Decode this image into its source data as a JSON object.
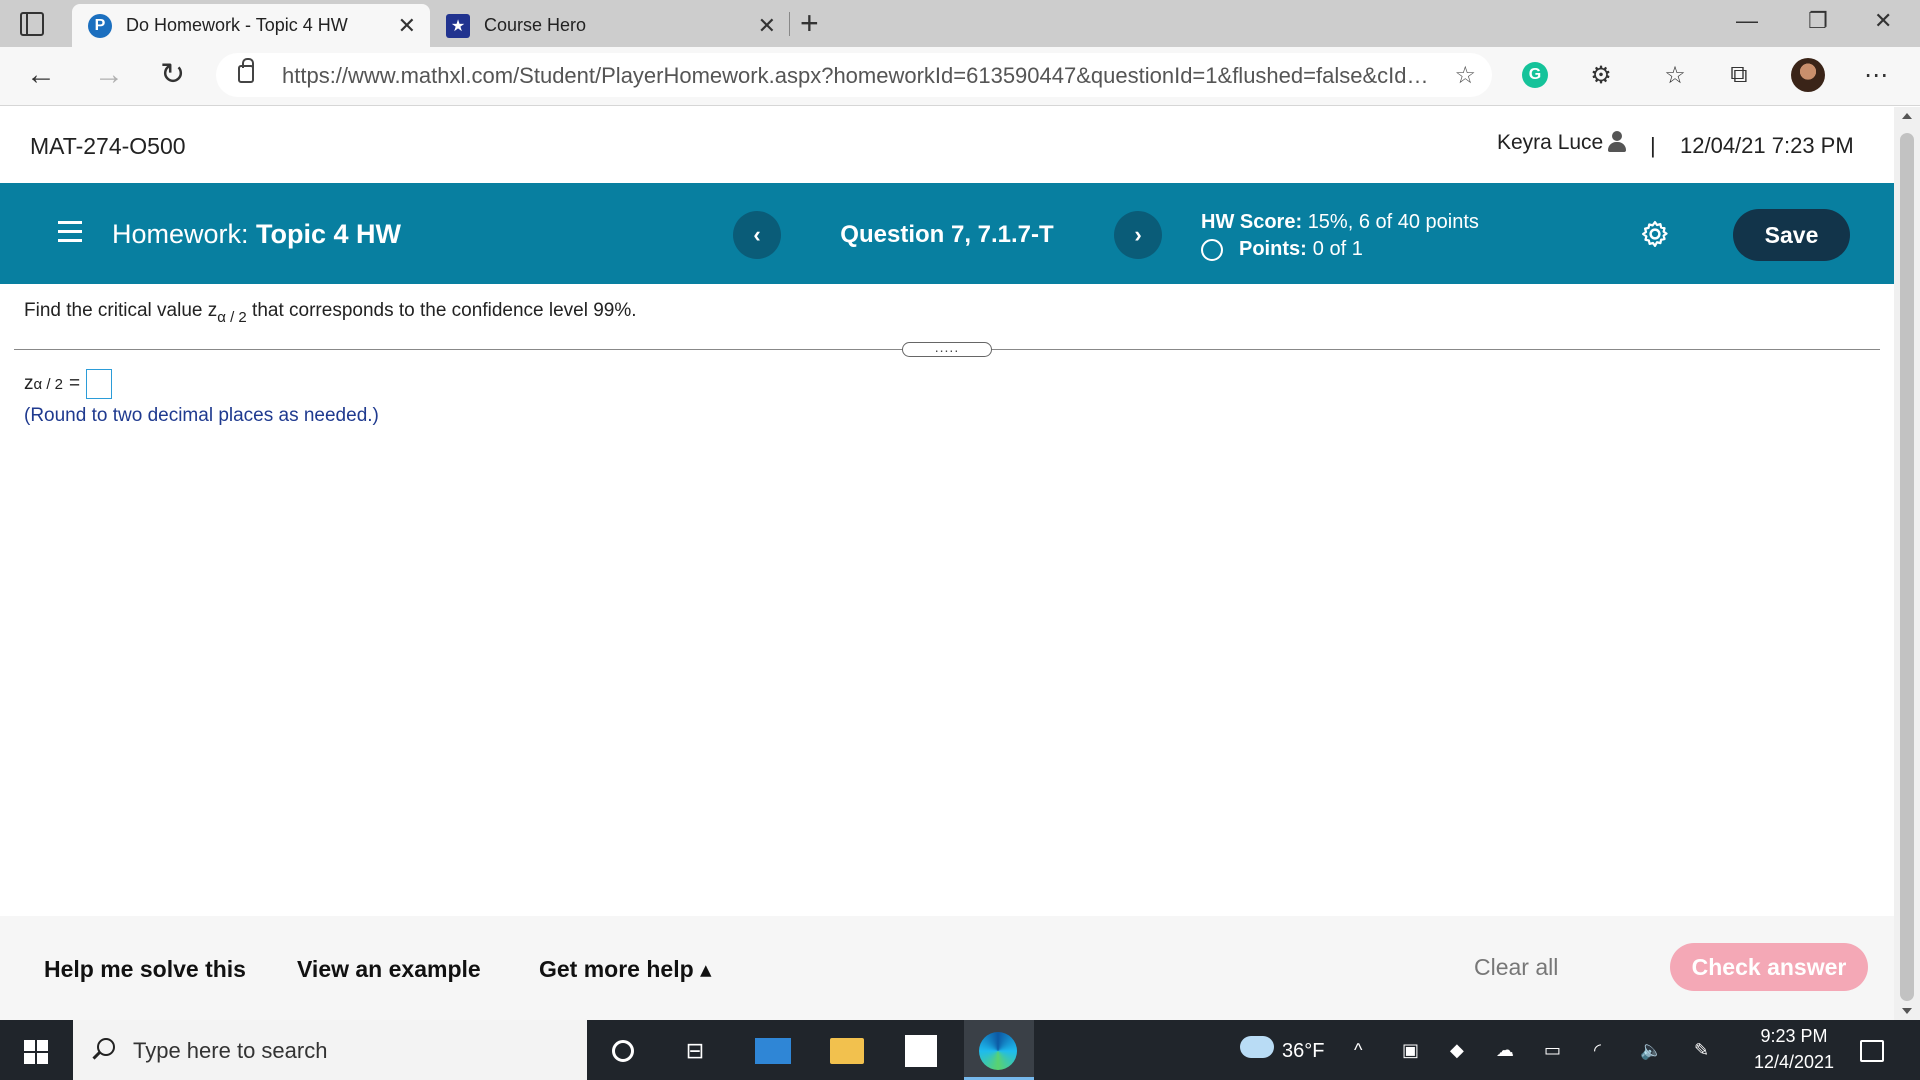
{
  "browser": {
    "tabs": [
      {
        "title": "Do Homework - Topic 4 HW",
        "favicon": "pearson-icon",
        "active": true
      },
      {
        "title": "Course Hero",
        "favicon": "course-hero-icon",
        "active": false
      }
    ],
    "url": "https://www.mathxl.com/Student/PlayerHomework.aspx?homeworkId=613590447&questionId=1&flushed=false&cId=67..."
  },
  "header": {
    "course": "MAT-274-O500",
    "user_name": "Keyra Luce",
    "separator": "|",
    "datetime": "12/04/21 7:23 PM"
  },
  "homework_bar": {
    "prefix": "Homework:",
    "title": "Topic 4 HW",
    "question": "Question 7, 7.1.7-T",
    "score_label": "HW Score:",
    "score_value": "15%, 6 of 40 points",
    "points_label": "Points:",
    "points_value": "0 of 1",
    "save_label": "Save",
    "colors": {
      "bar": "#087fa0",
      "save": "#12344a"
    }
  },
  "question": {
    "text_before": "Find the critical value z",
    "subscript": "α / 2",
    "text_after": " that corresponds to the confidence level 99%.",
    "answer_var": "z",
    "answer_sub": "α / 2",
    "equals": "=",
    "instruction": "(Round to two decimal places as needed.)",
    "handle_dots": "....."
  },
  "footer": {
    "help_solve": "Help me solve this",
    "view_example": "View an example",
    "more_help": "Get more help ▴",
    "clear_all": "Clear all",
    "check_answer": "Check answer",
    "colors": {
      "check_answer": "#f4a8b6"
    }
  },
  "taskbar": {
    "search_placeholder": "Type here to search",
    "temperature": "36°F",
    "time": "9:23 PM",
    "date": "12/4/2021"
  }
}
